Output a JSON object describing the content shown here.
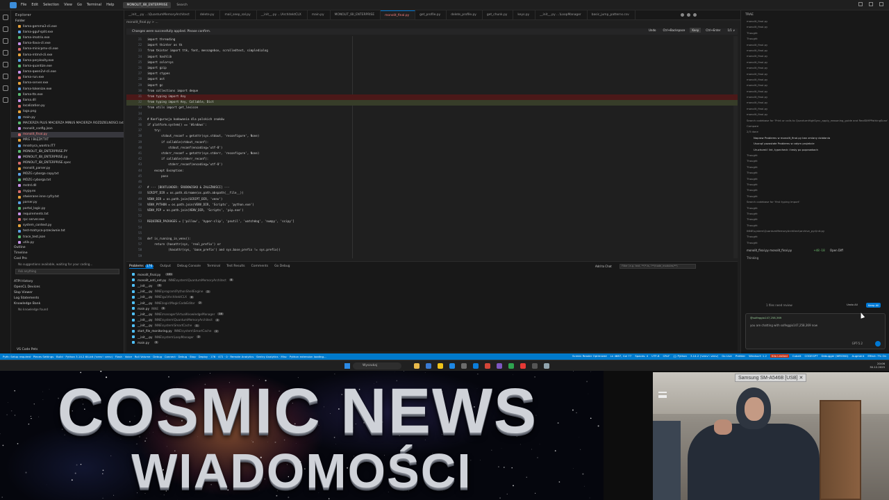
{
  "titlebar": {
    "menu": [
      "File",
      "Edit",
      "Selection",
      "View",
      "Go",
      "Terminal",
      "Help"
    ],
    "project": "MONOLIT_IBI_ENTERPRISE",
    "search": "Search"
  },
  "sidebar": {
    "title": "Explorer",
    "folder": "Folder",
    "files": [
      "llama-gemma3-cli.exe",
      "llama-gguf-split.exe",
      "llama-imatrix.exe",
      "llama-llava-cli.exe",
      "llama-minicpmv-cli.exe",
      "llama-mtmd-cli.exe",
      "llama-perplexity.exe",
      "llama-quantize.exe",
      "llama-qwen2vl-cli.exe",
      "llama-run.exe",
      "llama-server.exe",
      "llama-tokenize.exe",
      "llama-tts.exe",
      "llama.dll",
      "localization.py",
      "logo.png",
      "main.py",
      "MACIERZA PLUS MACIERZA MINUS MACIERZA ROZDZIELNOSCI.txt",
      "monolit_config.json",
      "monolit_final.py",
      "MRG I BŁĘDY.TXT",
      "mnatryca_wantra.IT7",
      "MONOLIT_IBI_ENTERPRISE.PY",
      "MONOLIT_IBI_ENTERPRISE.py",
      "MONOLIT_IBI_ENTERPRISE.spec",
      "monolit_parser.py",
      "MÓZG cyborga copy.txt",
      "MÓZG cyborga.txt",
      "mstrd.dll",
      "mypy.ex",
      "otwierane inne cyfry.txt",
      "parser.py",
      "portal_logic.py",
      "requirements.txt",
      "rpc server.exe",
      "system_context.py",
      "test-matryca-przeciwnie.txt",
      "trace_test.json",
      "utils.py"
    ],
    "sections": [
      "Outline",
      "Timeline"
    ],
    "cline_title": "Cool Pro",
    "cline_msg": "No suggestions available, waiting for your coding...",
    "cline_input": "Ask anything",
    "bottom_sections": [
      "ATPI History",
      "OpenCL Devices",
      "Slop Viewer",
      "Log Statements",
      "Knowledge Bank"
    ],
    "knowledge_empty": "No knowledge found",
    "footer": "VS Code Pets"
  },
  "tabs": [
    "__init__.py …\\QuantumMemoryArchitect",
    "delete.py",
    "mail_seep_sal.py",
    "__init__.py …\\ArchitektCLX",
    "main.py",
    "MONOLIT_IBI_ENTERPRISE",
    "monolit_final.py",
    "get_profile.py",
    "delete_profile.py",
    "get_chunk.py",
    "keys.py",
    "__init__.py …\\LoopManager",
    "basic_jump_patterns.csv"
  ],
  "editor": {
    "breadcrumb": "monolit_final.py > ...",
    "notice": "Changes were successfully applied. Please confirm.",
    "undo": "Undo",
    "undo_hint": "Ctrl+Backspace",
    "keep": "Keep",
    "keep_hint": "Ctrl+Enter",
    "counter": "1/1 ∨",
    "first_line": 21,
    "lines": [
      "import threading",
      "import tkinter as tk",
      "from tkinter import ttk, font, messagebox, scrolledtext, simpledialog",
      "import hashlib",
      "import colorsys",
      "import gzip",
      "import ctypes",
      "import ast",
      "import gc",
      "from collections import deque",
      "from typing import Any",
      "from typing import Any, Callable, Dict",
      "from utils import get_lexicon",
      "",
      "# Konfiguracja kodowania dla polskich znaków",
      "if platform.system() == 'Windows':",
      "    try:",
      "        stdout_reconf = getattr(sys.stdout, 'reconfigure', None)",
      "        if callable(stdout_reconf):",
      "            stdout_reconf(encoding='utf-8')",
      "        stderr_reconf = getattr(sys.stderr, 'reconfigure', None)",
      "        if callable(stderr_reconf):",
      "            stderr_reconf(encoding='utf-8')",
      "    except Exception:",
      "        pass",
      "",
      "# --- [BOOTLOADER: ŚRODOWISKO & ZALEŻNOŚCI] ---",
      "SCRIPT_DIR = os.path.dirname(os.path.abspath(__file__))",
      "VENV_DIR = os.path.join(SCRIPT_DIR, 'venv')",
      "VENV_PYTHON = os.path.join(VENV_DIR, 'Scripts', 'python.exe')",
      "VENV_PIP = os.path.join(VENV_DIR, 'Scripts', 'pip.exe')",
      "",
      "REQUIRED_PACKAGES = ['pillow', 'hyper-clip', 'psutil', 'watchdog', 'numpy', 'scipy']",
      "",
      "",
      "def is_running_in_venv():",
      "    return (hasattr(sys, 'real_prefix') or",
      "            (hasattr(sys, 'base_prefix') and sys.base_prefix != sys.prefix))",
      "",
      "",
      "def create_and_install_venv():"
    ]
  },
  "panel": {
    "tabs": [
      "Problems",
      "Output",
      "Debug Console",
      "Terminal",
      "Test Results",
      "Comments",
      "Go Debug"
    ],
    "problems_count": "176",
    "add_to_chat": "Add to Chat",
    "filter_placeholder": "Filter (e.g. text, **/*.ts, !**/node_modules/**)",
    "rows": [
      {
        "file": "monolit_final.py",
        "path": "",
        "count": "101"
      },
      {
        "file": "monolit_anti_ent.py",
        "path": "INNE\\system\\QuantumMemoryArchitect",
        "count": "8"
      },
      {
        "file": "__init__.py",
        "path": "",
        "count": "9"
      },
      {
        "file": "__init__.py",
        "path": "INNE\\program\\PythonShellEngine",
        "count": "2"
      },
      {
        "file": "__init__.py",
        "path": "INNE\\gui\\ArchitektCLX",
        "count": "6"
      },
      {
        "file": "__init__.py",
        "path": "INNE\\logic\\MagicCodeEditor",
        "count": "2"
      },
      {
        "file": "main.py",
        "path": "INNE",
        "count": "5"
      },
      {
        "file": "__init__.py",
        "path": "INNE\\manager\\VirtualKnowledgeManager",
        "count": "16"
      },
      {
        "file": "__init__.py",
        "path": "INNE\\system\\QuantumMemoryArchitect",
        "count": "2"
      },
      {
        "file": "__init__.py",
        "path": "INNE\\system\\SmartCache",
        "count": "1"
      },
      {
        "file": "start_file_monitoring.py",
        "path": "INNE\\system\\SmartCache",
        "count": "2"
      },
      {
        "file": "__init__.py",
        "path": "INNE\\system\\LoopManager",
        "count": "2"
      },
      {
        "file": "main.py",
        "path": "",
        "count": "5"
      }
    ]
  },
  "chat": {
    "title": "TRAE",
    "items": [
      "monolit_final.py",
      "monolit_final.py",
      "Thought",
      "Thought",
      "monolit_final.py",
      "monolit_final.py",
      "monolit_final.py",
      "monolit_final.py",
      "monolit_final.py",
      "monolit_final.py",
      "monolit_final.py",
      "monolit_final.py",
      "monolit_final.py",
      "monolit_final.py",
      "monolit_final.py",
      "monolit_final.py",
      "monolit_final.py",
      "Search codebase for 'Print or calls to QuantumHighSync_apply_reasoning_guide and RealSIMPPathingScan'",
      "Compare",
      "2/3 done"
    ],
    "todos": [
      "Napraw Problems w monolit_final.py bez zmiany działania",
      "Usunąć pozostałe Problems w całym projekcie",
      "Uruchomić lint, typecheck i testy po poprawkach"
    ],
    "items2": [
      "Thought",
      "Thought",
      "Thought",
      "Thought",
      "Thought",
      "Thought",
      "Thought",
      "Thought",
      "Search codebase for 'first typing import'",
      "Thought",
      "Thought",
      "Thought",
      "Thought",
      "INNE\\system\\QuantumMemoryArchitect\\archive_pyr\\init.py",
      "Thought",
      "Thought"
    ],
    "edited_file": "monolit_final.py monolit_final.py",
    "edited_stats": "+48 -18",
    "open_diff": "Open Diff",
    "thinking": "Thinking",
    "files_review": "1 files need review",
    "undo_all": "Undo All",
    "keep_all": "Keep All",
    "context_pill": "@solfeggio147,258,369",
    "input_text": "you are chatting with solfeggio147,258,369 now",
    "model": "GPT-5.2"
  },
  "statusbar": {
    "left": "Pyth: Setup required · Pieces Settings · Build · Python 3.14.2 64-bit ('venv': venv) · Flash · Voice · Roll Volume · Debug · Connect · Debug · Stop · Deploy · 176 · 472 · 0 · Remote Analytics · Sentry Analytics · Misc · Python extension loading...",
    "right": [
      "Screen Reader Optimized",
      "Ln 4687, Col 77",
      "Spaces: 4",
      "UTF-8",
      "CRLF",
      "{} Python",
      "3.14.2 ('venv': venv)",
      "Go Live",
      "Prettier",
      "Windsurf: 1.2",
      "Cubeit",
      "CODEGPT",
      "Debugger (WRONG)",
      "Augment",
      "Effect: 7% On"
    ],
    "warn_label": "Kilo Limited"
  },
  "taskbar": {
    "search": "Wyszukaj",
    "time": "20:06",
    "date": "30.12.2025"
  },
  "overlay": {
    "title1": "COSMIC NEWS",
    "title2": "WIADOMOŚCI"
  },
  "webcam": {
    "device_label": "Samsung SM-A546B [USB]"
  }
}
